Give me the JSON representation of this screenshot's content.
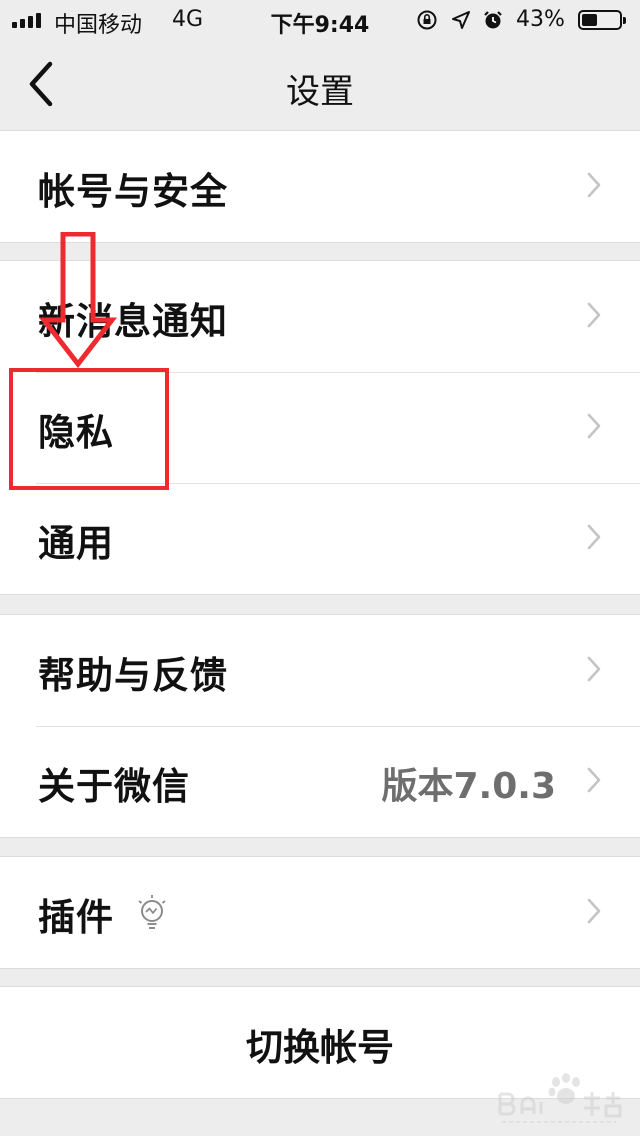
{
  "status_bar": {
    "carrier": "中国移动",
    "network": "4G",
    "time": "下午9:44",
    "battery_percent": "43%",
    "battery_level": 0.43,
    "icons": [
      "signal-icon",
      "rotation-lock-icon",
      "location-icon",
      "alarm-icon",
      "battery-icon"
    ]
  },
  "nav": {
    "title": "设置",
    "back_icon": "chevron-left-icon"
  },
  "groups": [
    {
      "items": [
        {
          "label": "帐号与安全"
        }
      ]
    },
    {
      "items": [
        {
          "label": "新消息通知"
        },
        {
          "label": "隐私"
        },
        {
          "label": "通用"
        }
      ]
    },
    {
      "items": [
        {
          "label": "帮助与反馈"
        },
        {
          "label": "关于微信",
          "value": "版本7.0.3"
        }
      ]
    },
    {
      "items": [
        {
          "label": "插件",
          "icon": "lightbulb-icon"
        }
      ]
    }
  ],
  "switch_account": {
    "label": "切换帐号"
  },
  "annotation": {
    "color": "#ee2a30",
    "highlighted_item": "隐私"
  },
  "colors": {
    "background": "#ededed",
    "cell": "#ffffff",
    "secondary_text": "#6e6e6e",
    "chevron": "#c4c4c4"
  }
}
